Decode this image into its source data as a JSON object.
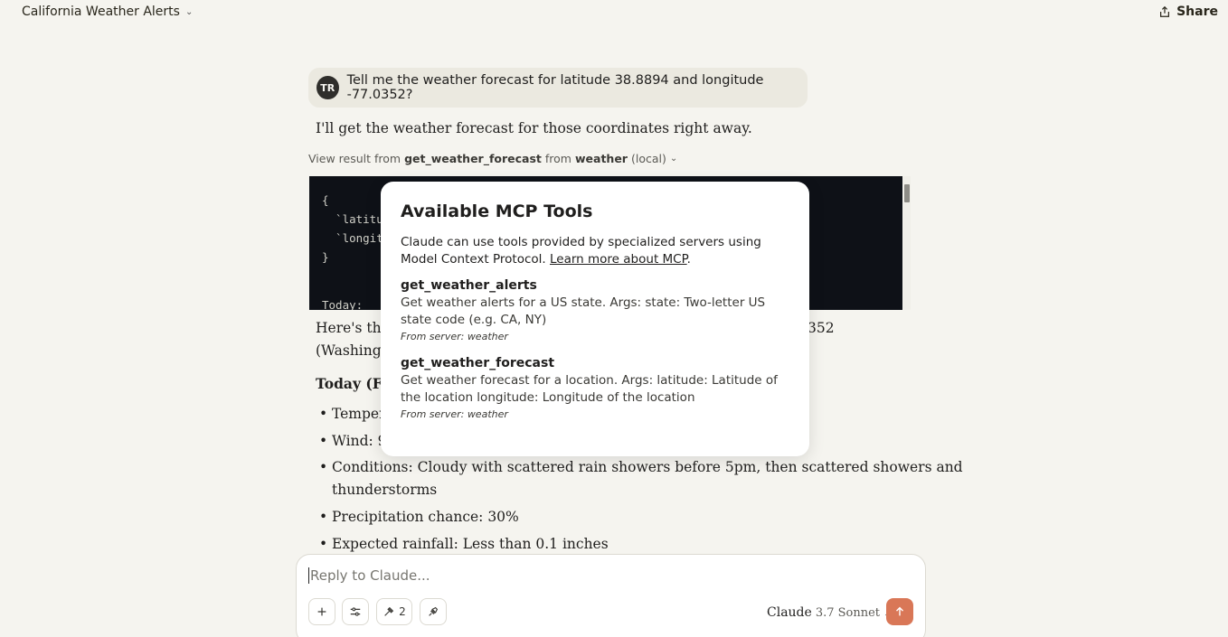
{
  "header": {
    "title": "California Weather Alerts",
    "share_label": "Share"
  },
  "user_message": {
    "avatar_initials": "TR",
    "text": "Tell me the weather forecast for latitude 38.8894 and longitude -77.0352?"
  },
  "assistant": {
    "intro": "I'll get the weather forecast for those coordinates right away.",
    "view_result": {
      "prefix": "View result from",
      "tool": "get_weather_forecast",
      "middle": "from",
      "server": "weather",
      "suffix": "(local)"
    },
    "code_lines": [
      "{",
      "  `latitu",
      "  `longitu",
      "}"
    ],
    "code_today": "Today:",
    "para_line1_start": "Here's the",
    "para_line1_end": "352",
    "para_line2_start": "(Washingto",
    "today_heading_partial": "Today (Fri",
    "bullets": {
      "temperature_partial": "Temper",
      "wind_partial": "Wind: 9",
      "conditions_line1": "Conditions: Cloudy with scattered rain showers before 5pm, then scattered showers and",
      "conditions_line2": "thunderstorms",
      "precipitation": "Precipitation chance: 30%",
      "rainfall": "Expected rainfall: Less than 0.1 inches"
    }
  },
  "modal": {
    "title": "Available MCP Tools",
    "description": "Claude can use tools provided by specialized servers using Model Context Protocol.",
    "learn_more": "Learn more about MCP",
    "tools": [
      {
        "name": "get_weather_alerts",
        "description": "Get weather alerts for a US state. Args: state: Two-letter US state code (e.g. CA, NY)",
        "server": "From server: weather"
      },
      {
        "name": "get_weather_forecast",
        "description": "Get weather forecast for a location. Args: latitude: Latitude of the location longitude: Longitude of the location",
        "server": "From server: weather"
      }
    ]
  },
  "composer": {
    "placeholder": "Reply to Claude...",
    "tools_count": "2",
    "model_name": "Claude",
    "model_version": "3.7 Sonnet"
  },
  "colors": {
    "background": "#f5f4ef",
    "send_button": "#d97757",
    "code_bg": "#0e1117"
  }
}
